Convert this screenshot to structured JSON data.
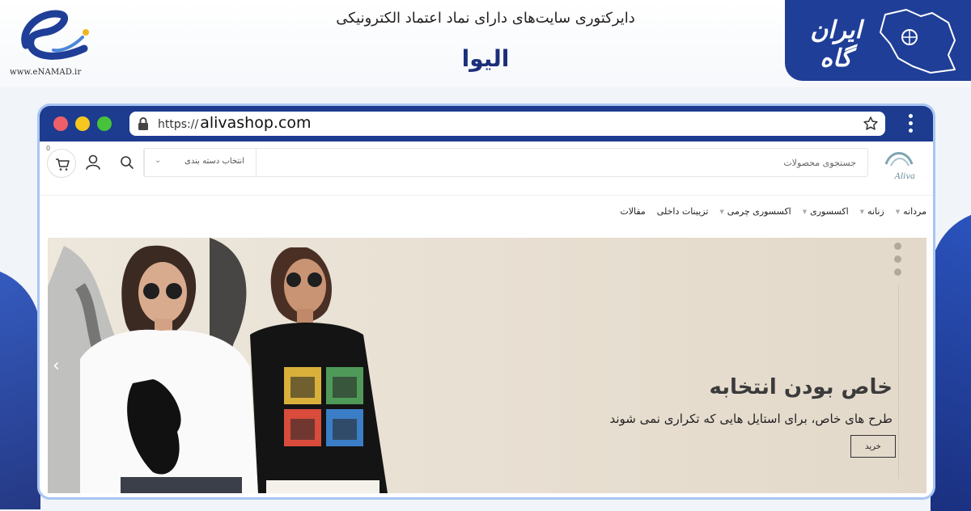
{
  "banner": {
    "directory_title": "دایرکتوری سایت‌های دارای نماد اعتماد الکترونیکی",
    "shop_name": "الیوا",
    "enamad_url": "www.eNAMAD.ir",
    "irangah_label": "ایران گاه"
  },
  "browser": {
    "url_scheme": "https://",
    "url_host": "alivashop.com"
  },
  "site": {
    "logo_text": "Aliva",
    "search_placeholder": "جستجوی محصولات",
    "category_label": "انتخاب دسته بندی",
    "cart_count": "0",
    "nav": [
      {
        "label": "مردانه"
      },
      {
        "label": "زنانه"
      },
      {
        "label": "اکسسوری"
      },
      {
        "label": "اکسسوری چرمی"
      },
      {
        "label": "تزیینات داخلی"
      },
      {
        "label": "مقالات"
      }
    ]
  },
  "hero": {
    "heading": "خاص بودن انتخابه",
    "subtitle": "طرح های خاص، برای استایل هایی که تکراری نمی شوند",
    "cta_label": "خرید"
  },
  "colors": {
    "brand_blue": "#1d3b8f",
    "badge_blue": "#1f3e97",
    "hero_bg": "#e9e1d4"
  }
}
